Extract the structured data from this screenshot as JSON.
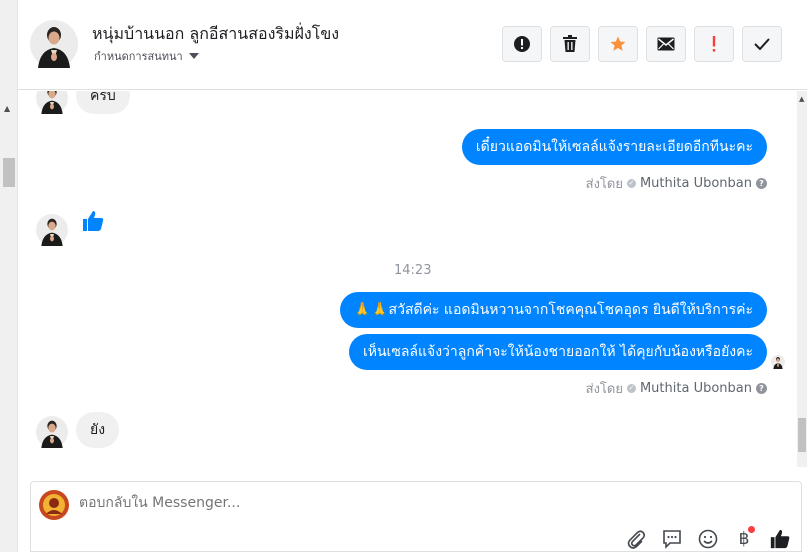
{
  "header": {
    "contact_name": "หนุ่มบ้านนอก ลูกอีสานสองริมฝั่งโขง",
    "subtitle": "กำหนดการสนทนา"
  },
  "actions": [
    {
      "name": "mark-spam-button",
      "icon": "exclamation-circle-icon"
    },
    {
      "name": "delete-button",
      "icon": "trash-icon"
    },
    {
      "name": "star-button",
      "icon": "star-icon",
      "color": "#f7923b"
    },
    {
      "name": "mark-unread-button",
      "icon": "envelope-icon"
    },
    {
      "name": "follow-up-button",
      "icon": "exclamation-icon",
      "color": "#fa3e3e"
    },
    {
      "name": "mark-done-button",
      "icon": "check-icon"
    }
  ],
  "messages": {
    "in_1": "ครบ",
    "out_1": "เดี๋ยวแอดมินให้เซลล์แจ้งรายละเอียดอีกทีนะคะ",
    "sent_by_label": "ส่งโดย",
    "sent_by_name": "Muthita Ubonban",
    "timestamp": "14:23",
    "out_2": "🙏🙏สวัสดีค่ะ แอดมินหวานจากโชคคุณโชคอุดร ยินดีให้บริการค่ะ",
    "out_3": "เห็นเซลล์แจ้งว่าลูกค้าจะให้น้องชายออกให้ ได้คุยกับน้องหรือยังคะ",
    "in_2": "ยัง"
  },
  "composer": {
    "placeholder": "ตอบกลับใน Messenger...",
    "tools": [
      "paperclip-icon",
      "speech-bubble-icon",
      "smiley-icon",
      "baht-icon",
      "thumbs-up-icon"
    ],
    "baht_symbol": "฿"
  },
  "colors": {
    "outgoing_bubble": "#0084ff",
    "incoming_bubble": "#f1f0f0",
    "like": "#0084ff"
  }
}
